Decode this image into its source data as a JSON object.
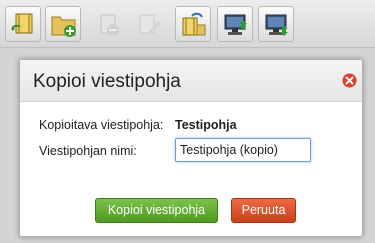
{
  "toolbar": {
    "buttons": [
      {
        "icon": "binder-refresh-icon",
        "enabled": true
      },
      {
        "icon": "folder-add-icon",
        "enabled": true
      },
      {
        "icon": "delete-icon",
        "enabled": false
      },
      {
        "icon": "edit-icon",
        "enabled": false
      },
      {
        "icon": "binder-copy-icon",
        "enabled": true
      },
      {
        "icon": "monitor-upload-icon",
        "enabled": true
      },
      {
        "icon": "monitor-download-icon",
        "enabled": true
      }
    ]
  },
  "dialog": {
    "title": "Kopioi viestipohja",
    "source_label": "Kopioitava viestipohja:",
    "source_value": "Testipohja",
    "name_label": "Viestipohjan nimi:",
    "name_value": "Testipohja (kopio)",
    "copy_button": "Kopioi viestipohja",
    "cancel_button": "Peruuta"
  },
  "colors": {
    "primary_button": "#5aa82b",
    "cancel_button": "#dd5530",
    "close_icon": "#d9412a"
  }
}
